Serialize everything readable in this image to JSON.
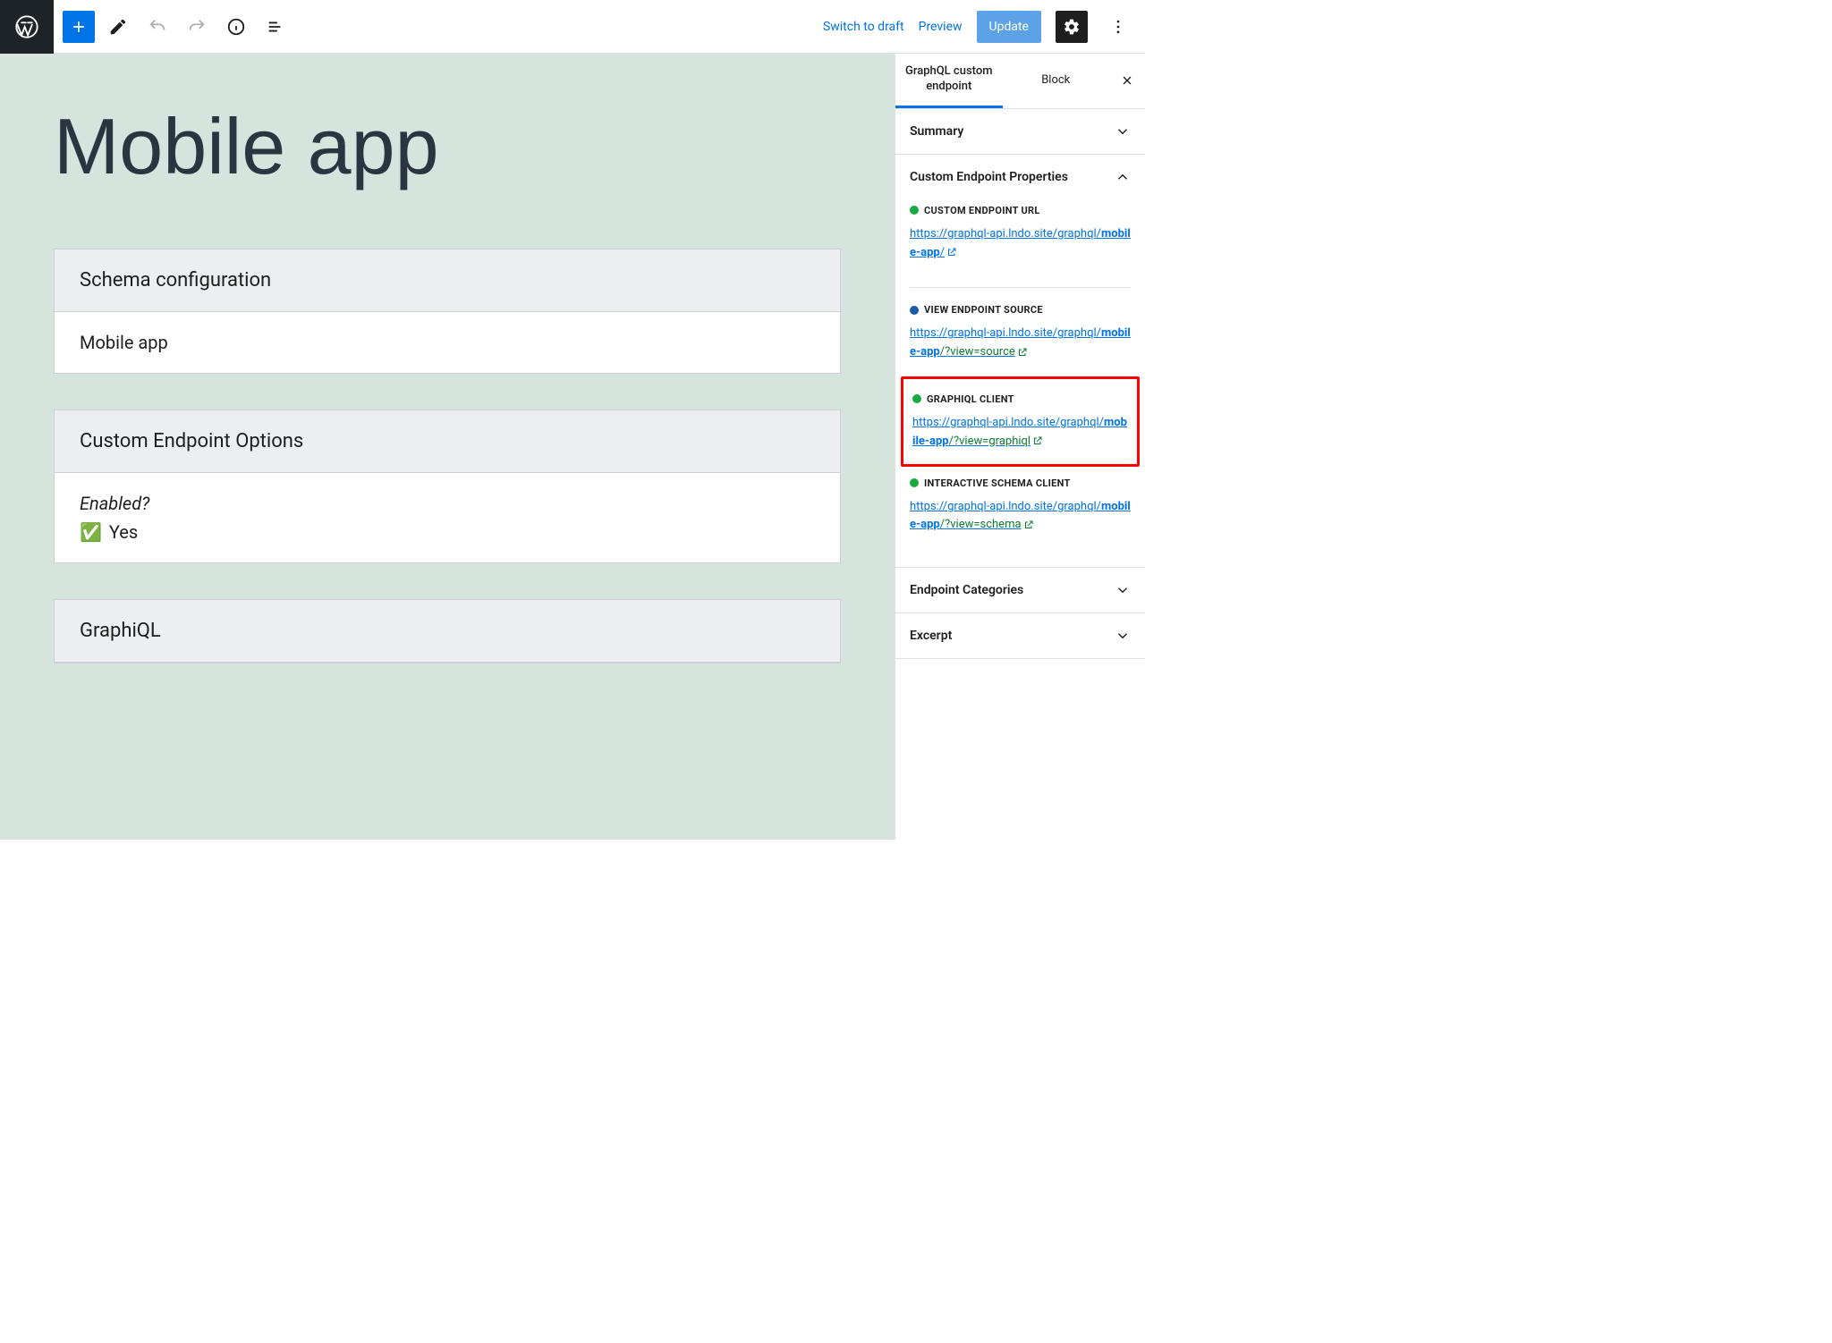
{
  "toolbar": {
    "switch_draft": "Switch to draft",
    "preview": "Preview",
    "update": "Update"
  },
  "page": {
    "title": "Mobile app"
  },
  "blocks": {
    "schema_config": {
      "heading": "Schema configuration",
      "value": "Mobile app"
    },
    "endpoint_options": {
      "heading": "Custom Endpoint Options",
      "enabled_label": "Enabled?",
      "enabled_value": "Yes"
    },
    "graphiql": {
      "heading": "GraphiQL"
    }
  },
  "sidebar": {
    "tab1": "GraphQL custom endpoint",
    "tab2": "Block",
    "panels": {
      "summary": "Summary",
      "props": "Custom Endpoint Properties",
      "endpoint_categories": "Endpoint Categories",
      "excerpt": "Excerpt"
    },
    "props": {
      "url_label": "CUSTOM ENDPOINT URL",
      "url_pre": "https://graphql-api.lndo.site/graphql/",
      "url_slug": "mobile-app",
      "url_post": "/",
      "source_label": "VIEW ENDPOINT SOURCE",
      "source_pre": "https://graphql-api.lndo.site/graphql/",
      "source_slug": "mobile-app",
      "source_q": "/?view=source",
      "graphiql_label": "GRAPHIQL CLIENT",
      "graphiql_pre": "https://graphql-api.lndo.site/graphql/",
      "graphiql_slug": "mobile-app",
      "graphiql_q": "/?view=graphiql",
      "schema_label": "INTERACTIVE SCHEMA CLIENT",
      "schema_pre": "https://graphql-api.lndo.site/graphql/",
      "schema_slug": "mobile-app",
      "schema_q": "/?view=schema"
    }
  }
}
